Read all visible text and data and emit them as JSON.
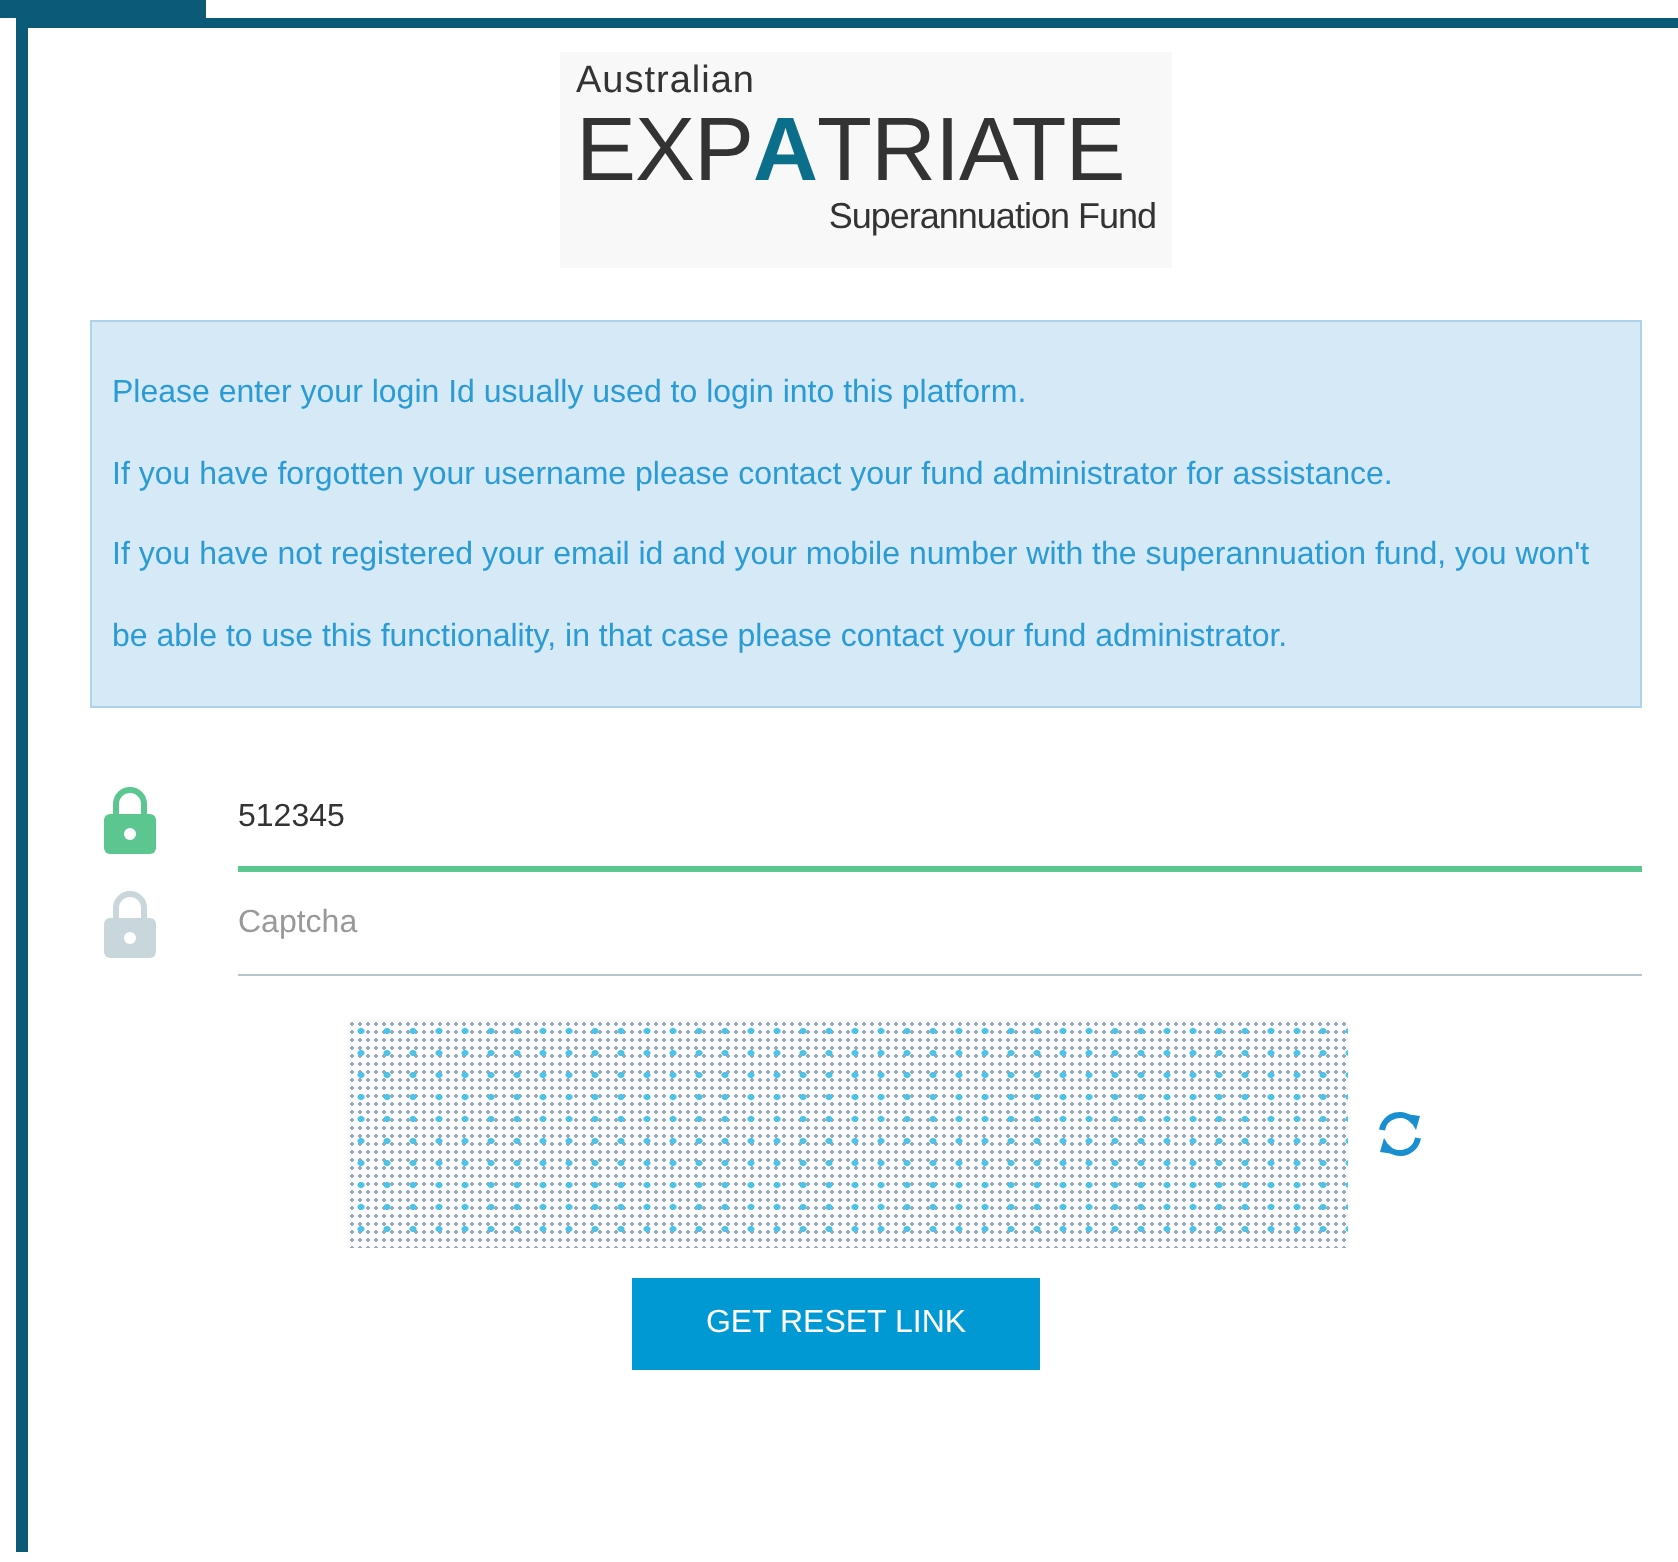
{
  "logo": {
    "top": "Australian",
    "main": "EXPATRIATE",
    "bottom": "Superannuation Fund"
  },
  "info": [
    "Please enter your login Id usually used to login into this platform.",
    "If you have forgotten your username please contact your fund administrator for assistance.",
    "If you have not registered your email id and your mobile number with the superannuation fund, you won't be able to use this functionality, in that case please contact your fund administrator."
  ],
  "fields": [
    {
      "value": "512345",
      "focused": true
    },
    {
      "placeholder": "Captcha",
      "focused": false
    }
  ],
  "button": "GET RESET LINK"
}
